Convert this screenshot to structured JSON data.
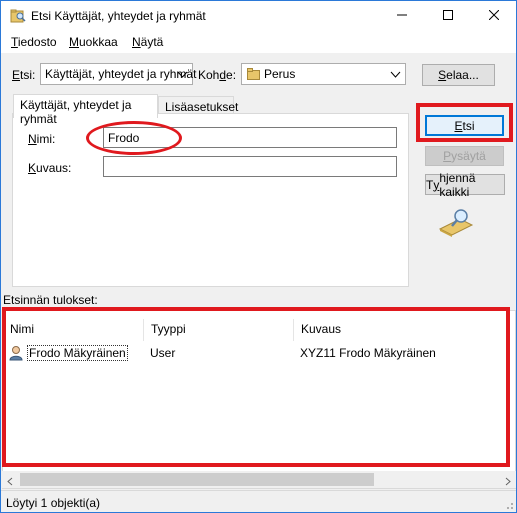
{
  "window": {
    "title": "Etsi Käyttäjät, yhteydet ja ryhmät",
    "icons": [
      "folder-search-icon",
      "minimize-icon",
      "maximize-icon",
      "close-icon"
    ]
  },
  "menu": {
    "file": {
      "accel": "T",
      "rest": "iedosto"
    },
    "edit": {
      "accel": "M",
      "rest": "uokkaa"
    },
    "view": {
      "accel": "N",
      "rest": "äytä"
    }
  },
  "find": {
    "label_accel": "E",
    "label_rest": "tsi:",
    "value": "Käyttäjät, yhteydet ja ryhmät"
  },
  "location": {
    "label_pre": "Koh",
    "label_accel": "d",
    "label_post": "e:",
    "value": "Perus"
  },
  "browse_button": {
    "pre": "",
    "accel": "S",
    "post": "elaa..."
  },
  "tabs": [
    {
      "label": "Käyttäjät, yhteydet ja ryhmät",
      "active": true
    },
    {
      "label": "Lisäasetukset",
      "active": false
    }
  ],
  "form": {
    "name": {
      "label_accel": "N",
      "label_rest": "imi:",
      "value": "Frodo"
    },
    "description": {
      "label_accel": "K",
      "label_rest": "uvaus:",
      "value": ""
    }
  },
  "actions": {
    "find_now": {
      "pre": "",
      "accel": "E",
      "post": "tsi"
    },
    "stop": {
      "pre": "",
      "accel": "P",
      "post": "ysäytä"
    },
    "clear_all": {
      "pre": "T",
      "accel": "y",
      "post": "hjennä kaikki"
    }
  },
  "results": {
    "label": "Etsinnän tulokset:",
    "columns": [
      "Nimi",
      "Tyyppi",
      "Kuvaus"
    ],
    "rows": [
      {
        "name": "Frodo Mäkyräinen",
        "type": "User",
        "description": "XYZ11 Frodo Mäkyräinen",
        "icon": "user-icon"
      }
    ]
  },
  "status": "Löytyi 1 objekti(a)",
  "colors": {
    "highlight": "#e0191e",
    "accent": "#0078d7"
  }
}
